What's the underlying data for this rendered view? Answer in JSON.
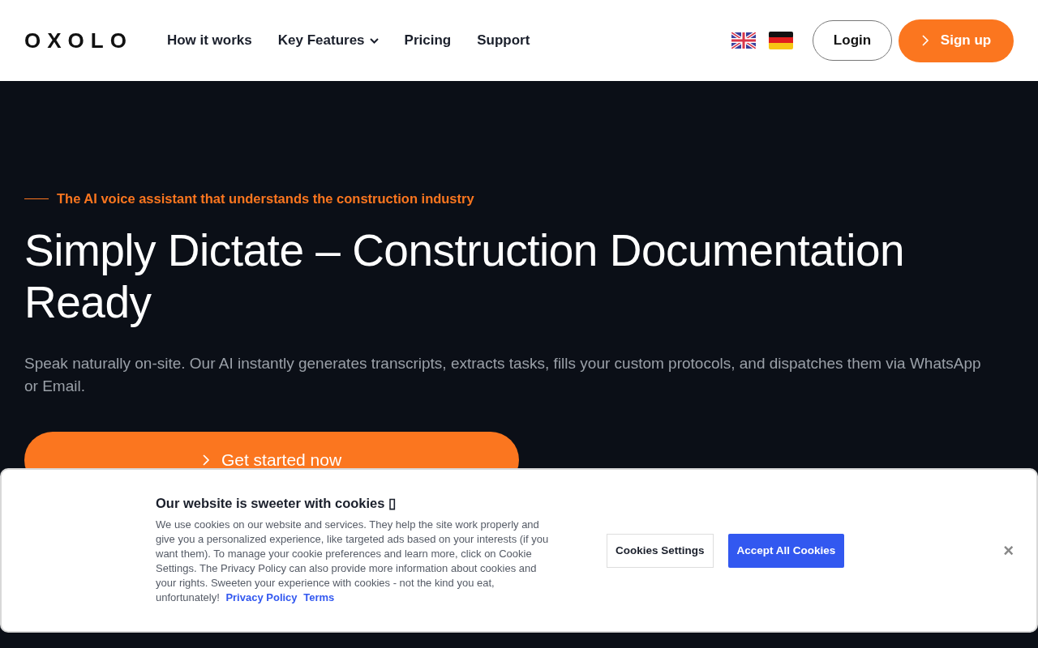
{
  "header": {
    "logo": "OXOLO",
    "nav": [
      {
        "label": "How it works",
        "dropdown": false
      },
      {
        "label": "Key Features",
        "dropdown": true
      },
      {
        "label": "Pricing",
        "dropdown": false
      },
      {
        "label": "Support",
        "dropdown": false
      }
    ],
    "languages": [
      {
        "kind": "uk"
      },
      {
        "kind": "de"
      }
    ],
    "login": "Login",
    "signup": "Sign up"
  },
  "hero": {
    "tagline": "The AI voice assistant that understands the construction industry",
    "title": "Simply Dictate – Construction Documentation Ready",
    "description": "Speak naturally on-site. Our AI instantly generates transcripts, extracts tasks, fills your custom protocols, and dispatches them via WhatsApp or Email.",
    "cta": "Get started now"
  },
  "cookie_banner": {
    "title": "Our website is sweeter with cookies ▯",
    "text": "We use cookies on our website and services. They help the site work properly and give you a personalized experience, like targeted ads based on your interests (if you want them). To manage your cookie preferences and learn more, click on Cookie Settings. The Privacy Policy can also provide more information about cookies and your rights. Sweeten your experience with cookies - not the kind you eat, unfortunately!",
    "links": [
      "Privacy Policy",
      "Terms"
    ],
    "settings_button": "Cookies Settings",
    "accept_button": "Accept All Cookies",
    "close": "×"
  }
}
